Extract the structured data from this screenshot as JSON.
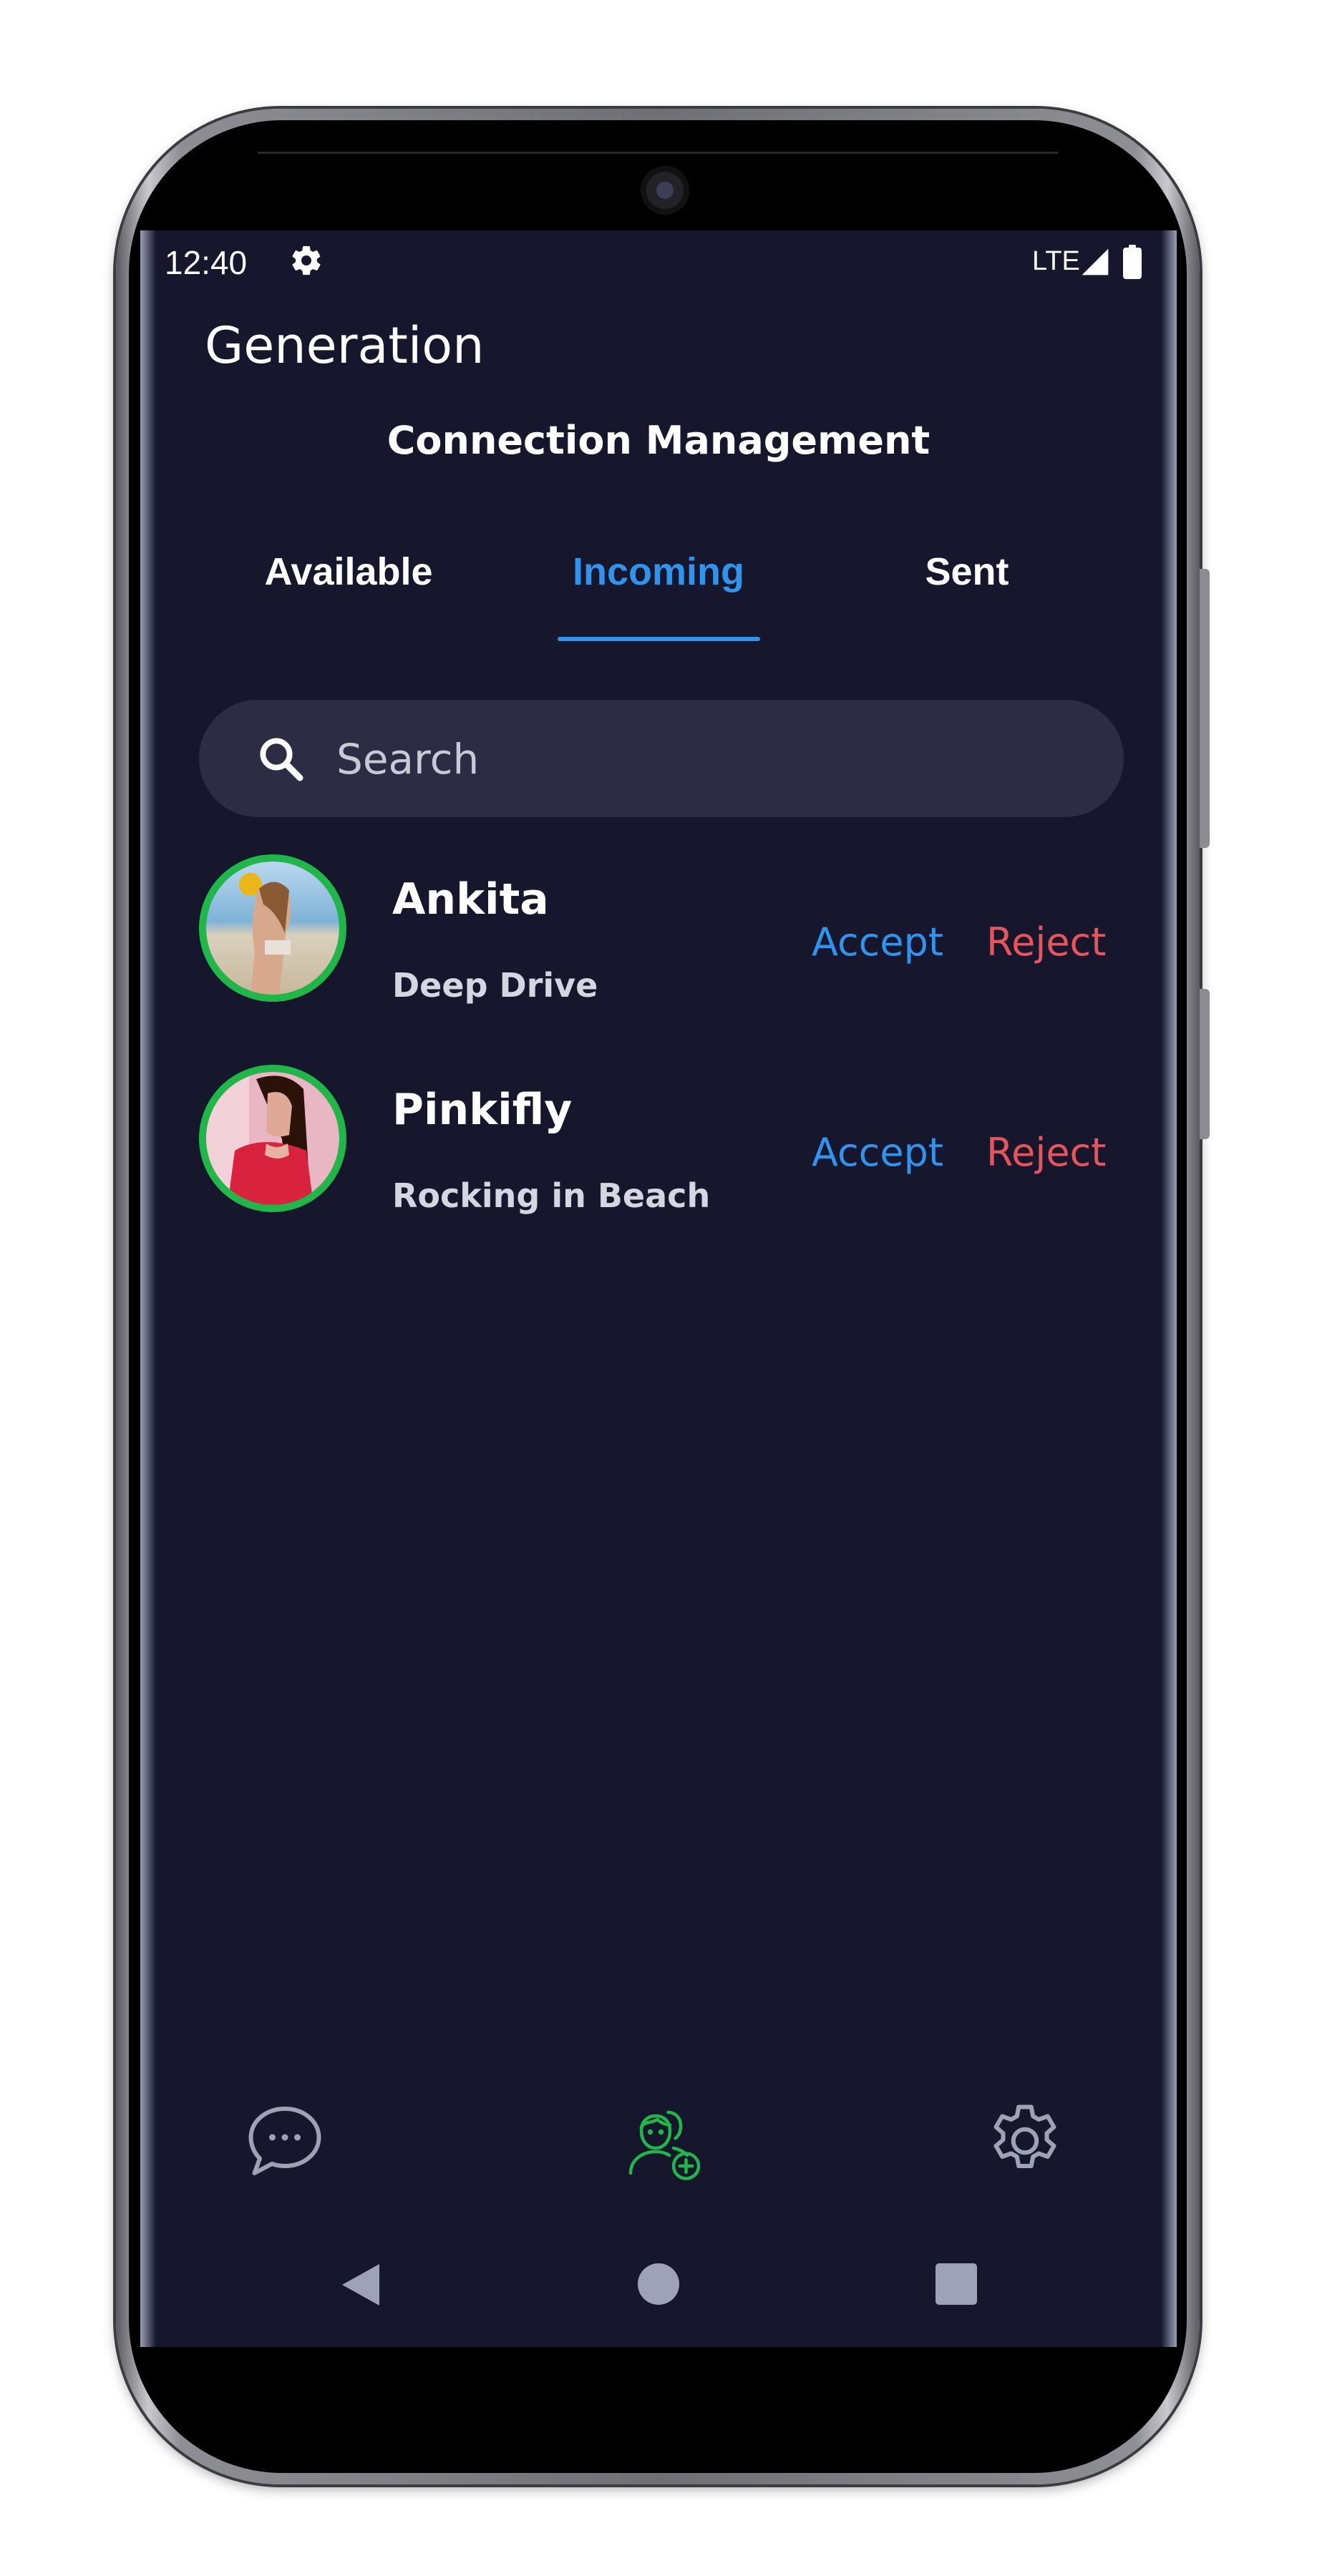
{
  "status_bar": {
    "time": "12:40",
    "network": "LTE",
    "icons": [
      "gear-icon",
      "signal-icon",
      "battery-icon"
    ]
  },
  "app": {
    "title": "Generation",
    "page_title": "Connection Management"
  },
  "tabs": [
    {
      "label": "Available",
      "active": false
    },
    {
      "label": "Incoming",
      "active": true
    },
    {
      "label": "Sent",
      "active": false
    }
  ],
  "search": {
    "placeholder": "Search",
    "value": ""
  },
  "requests": [
    {
      "name": "Ankita",
      "status": "Deep Drive",
      "accept_label": "Accept",
      "reject_label": "Reject"
    },
    {
      "name": "Pinkifly",
      "status": "Rocking in Beach",
      "accept_label": "Accept",
      "reject_label": "Reject"
    }
  ],
  "bottom_nav": [
    {
      "icon": "chat-icon"
    },
    {
      "icon": "add-connection-icon",
      "active": true
    },
    {
      "icon": "settings-icon"
    }
  ],
  "system_nav": [
    "back-icon",
    "home-icon",
    "recents-icon"
  ],
  "colors": {
    "background": "#16162d",
    "accent": "#2e94ee",
    "reject": "#e9545b",
    "online_ring": "#1fb848",
    "search_bg": "#2c2c44"
  }
}
